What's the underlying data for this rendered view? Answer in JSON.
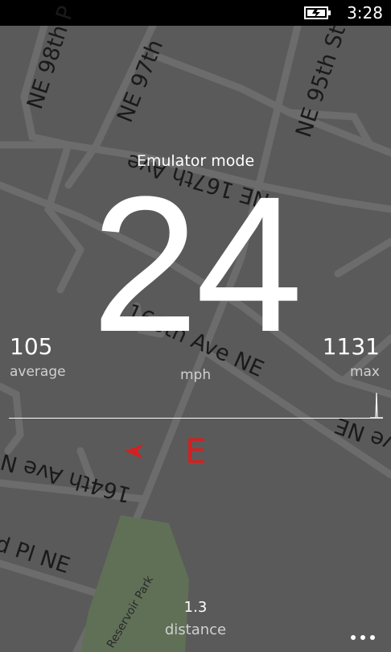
{
  "status_bar": {
    "time": "3:28",
    "battery_icon": "battery-charging-icon"
  },
  "map": {
    "streets": {
      "ne98th": "NE 98th P",
      "ne97th": "NE 97th",
      "ne95th": "NE 95th St",
      "ave167": "NE 167th Ave",
      "ave166": "166th Ave NE",
      "ave164": "164th Ave N",
      "pl": "d Pl NE",
      "ne_right": "ve NE"
    },
    "park": "Reservoir Park"
  },
  "main": {
    "mode": "Emulator mode",
    "speed": "24",
    "unit": "mph",
    "average_value": "105",
    "average_label": "average",
    "max_value": "1131",
    "max_label": "max",
    "heading": "E",
    "heading_icon": "direction-arrow-icon",
    "distance_value": "1.3",
    "distance_label": "distance"
  },
  "app_bar": {
    "more_icon": "more-ellipsis-icon"
  },
  "colors": {
    "accent": "#d42020",
    "map_bg": "#5a5a5a",
    "roads": "#6c6c6c"
  }
}
